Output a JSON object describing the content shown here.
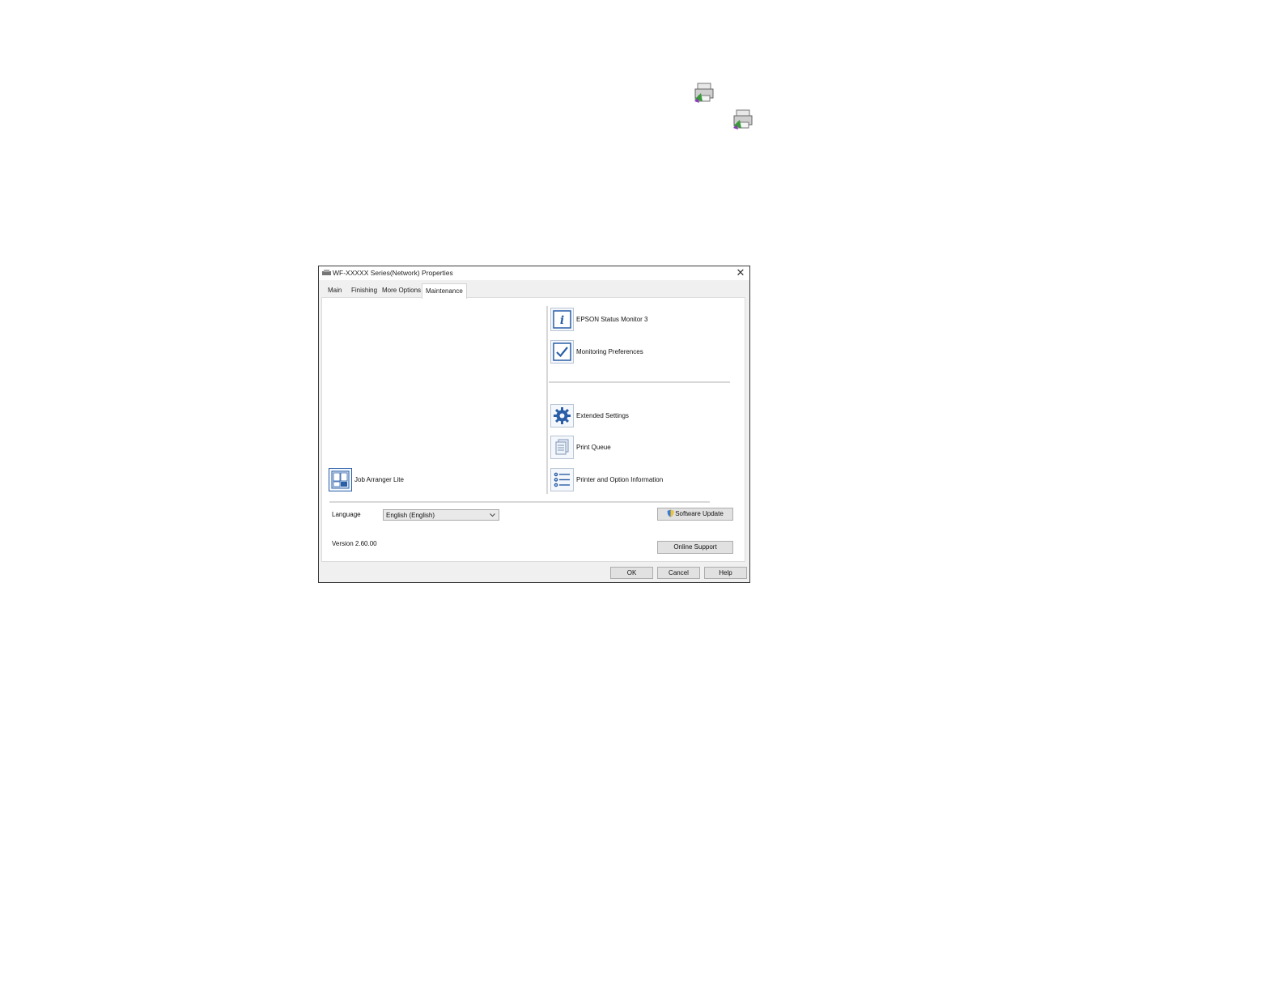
{
  "page_icons": [
    {
      "name": "printer-icon",
      "description_color": "#5a8a3a"
    },
    {
      "name": "printer-icon",
      "description_color": "#5a8a3a"
    }
  ],
  "dialog": {
    "title": "WF-XXXXX Series(Network) Properties",
    "close_glyph": "✕",
    "tabs": [
      {
        "label": "Main",
        "active": false
      },
      {
        "label": "Finishing",
        "active": false
      },
      {
        "label": "More Options",
        "active": false
      },
      {
        "label": "Maintenance",
        "active": true
      }
    ],
    "tools": {
      "status_monitor": {
        "label": "EPSON Status Monitor 3",
        "icon": "info-icon"
      },
      "monitoring_prefs": {
        "label": "Monitoring Preferences",
        "icon": "checkbox-icon"
      },
      "extended_settings": {
        "label": "Extended Settings",
        "icon": "gear-icon"
      },
      "print_queue": {
        "label": "Print Queue",
        "icon": "document-stack-icon"
      },
      "printer_info": {
        "label": "Printer and Option Information",
        "icon": "list-icon"
      },
      "job_arranger": {
        "label": "Job Arranger Lite",
        "icon": "job-arranger-icon"
      }
    },
    "language": {
      "label": "Language",
      "selected": "English (English)"
    },
    "version": "Version 2.60.00",
    "software_update_label": "Software Update",
    "online_support_label": "Online Support",
    "ok_label": "OK",
    "cancel_label": "Cancel",
    "help_label": "Help",
    "colors": {
      "icon_blue": "#2a5fa8",
      "accent_gray": "#f0f0f0"
    }
  }
}
